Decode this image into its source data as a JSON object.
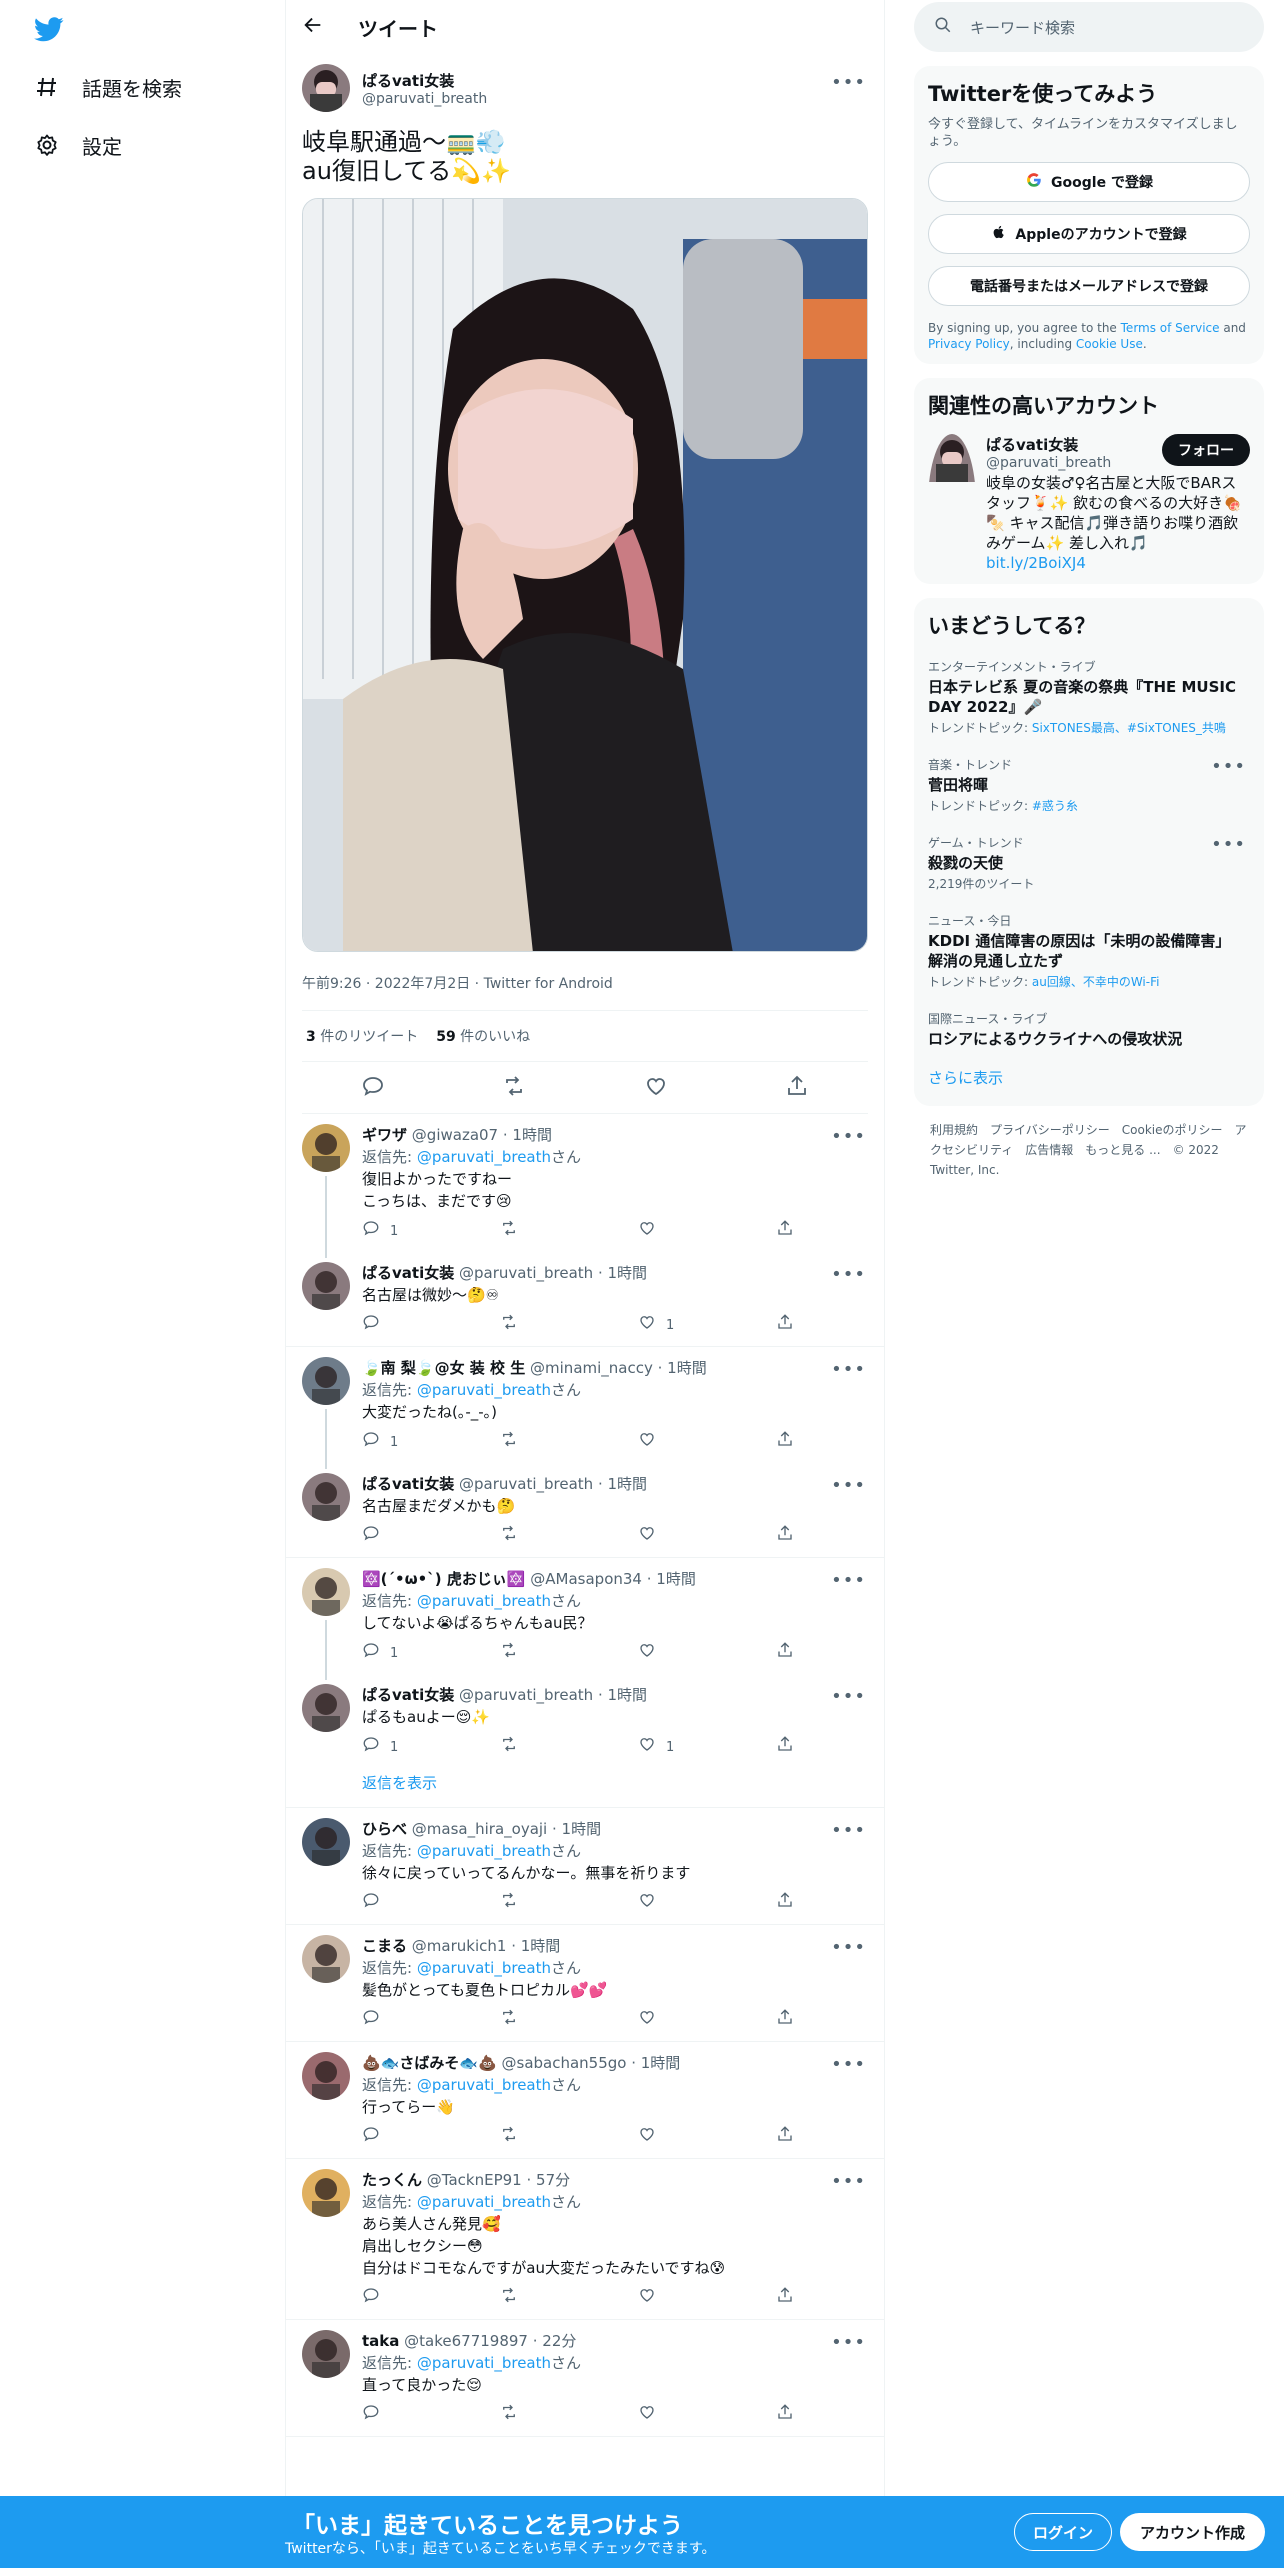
{
  "nav": {
    "explore": "話題を検索",
    "settings": "設定"
  },
  "header": {
    "title": "ツイート"
  },
  "tweet": {
    "name": "ぱるvati女装",
    "handle": "@paruvati_breath",
    "line1": "岐阜駅通過〜🚃💨",
    "line2": "au復旧してる💫✨",
    "meta": "午前9:26 · 2022年7月2日 · Twitter for Android",
    "retweets": "3",
    "retweets_label": "件のリツイート",
    "likes": "59",
    "likes_label": "件のいいね"
  },
  "reply_to_label": "返信先: ",
  "reply_to_suffix": "さん",
  "replies": [
    {
      "name": "ギワザ",
      "handle": "@giwaza07 · 1時間",
      "to": "@paruvati_breath",
      "lines": [
        "復旧よかったですねー",
        "こっちは、まだです😢"
      ],
      "reply_count": "1",
      "like_count": ""
    },
    {
      "name": "ぱるvati女装",
      "handle": "@paruvati_breath · 1時間",
      "to": "",
      "lines": [
        "名古屋は微妙〜🤔♾"
      ],
      "reply_count": "",
      "like_count": "1"
    },
    {
      "name": "🍃南 梨🍃@女 装 校 生",
      "handle": "@minami_naccy · 1時間",
      "to": "@paruvati_breath",
      "lines": [
        "大変だったね(｡-_-｡)"
      ],
      "reply_count": "1",
      "like_count": ""
    },
    {
      "name": "ぱるvati女装",
      "handle": "@paruvati_breath · 1時間",
      "to": "",
      "lines": [
        "名古屋まだダメかも🤔"
      ],
      "reply_count": "",
      "like_count": ""
    },
    {
      "name": "🔯(ˊ•ω•ˋ) 虎おじぃ🔯",
      "handle": "@AMasapon34 · 1時間",
      "to": "@paruvati_breath",
      "lines": [
        "してないよ😭ぱるちゃんもau民？"
      ],
      "reply_count": "1",
      "like_count": ""
    },
    {
      "name": "ぱるvati女装",
      "handle": "@paruvati_breath · 1時間",
      "to": "",
      "lines": [
        "ぱるもauよー😌✨"
      ],
      "reply_count": "1",
      "like_count": "1"
    },
    {
      "name": "ひらべ",
      "handle": "@masa_hira_oyaji · 1時間",
      "to": "@paruvati_breath",
      "lines": [
        "徐々に戻っていってるんかなー。無事を祈ります"
      ],
      "reply_count": "",
      "like_count": ""
    },
    {
      "name": "こまる",
      "handle": "@marukich1 · 1時間",
      "to": "@paruvati_breath",
      "lines": [
        "髪色がとっても夏色トロピカル💕💕"
      ],
      "reply_count": "",
      "like_count": ""
    },
    {
      "name": "💩🐟さばみそ🐟💩",
      "handle": "@sabachan55go · 1時間",
      "to": "@paruvati_breath",
      "lines": [
        "行ってらー👋"
      ],
      "reply_count": "",
      "like_count": ""
    },
    {
      "name": "たっくん",
      "handle": "@TacknEP91 · 57分",
      "to": "@paruvati_breath",
      "lines": [
        "あら美人さん発見🥰",
        "肩出しセクシー😳",
        "自分はドコモなんですがau大変だったみたいですね😰"
      ],
      "reply_count": "",
      "like_count": ""
    },
    {
      "name": "taka",
      "handle": "@take67719897 · 22分",
      "to": "@paruvati_breath",
      "lines": [
        "直って良かった😌"
      ],
      "reply_count": "",
      "like_count": ""
    }
  ],
  "show_replies": "返信を表示",
  "right": {
    "search_placeholder": "キーワード検索",
    "signup_title": "Twitterを使ってみよう",
    "signup_sub": "今すぐ登録して、タイムラインをカスタマイズしましょう。",
    "google_btn": "Google で登録",
    "apple_btn": "Appleのアカウントで登録",
    "phone_btn": "電話番号またはメールアドレスで登録",
    "terms_1": "By signing up, you agree to the ",
    "terms_tos": "Terms of Service",
    "terms_and": " and ",
    "terms_privacy": "Privacy Policy",
    "terms_2": ", including ",
    "terms_cookie": "Cookie Use",
    "terms_3": ".",
    "related_title": "関連性の高いアカウント",
    "related_name": "ぱるvati女装",
    "related_handle": "@paruvati_breath",
    "follow": "フォロー",
    "related_bio": "岐阜の女装♂♀名古屋と大阪でBARスタッフ🍹✨ 飲むの食べるの大好き🍖🍢 キャス配信🎵弾き語りお喋り酒飲みゲーム✨ 差し入れ🎵",
    "related_link": "bit.ly/2BoiXJ4",
    "trends_title": "いまどうしてる？",
    "trends": [
      {
        "cat": "エンターテインメント・ライブ",
        "t": "日本テレビ系 夏の音楽の祭典『THE MUSIC DAY 2022』🎤",
        "sub_label": "トレンドトピック: ",
        "sub_link": "SixTONES最高、#SixTONES_共鳴"
      },
      {
        "cat": "音楽・トレンド",
        "t": "菅田将暉",
        "sub_label": "トレンドトピック: ",
        "sub_link": "#惑う糸"
      },
      {
        "cat": "ゲーム・トレンド",
        "t": "殺戮の天使",
        "sub_label": "2,219件のツイート",
        "sub_link": ""
      },
      {
        "cat": "ニュース・今日",
        "t": "KDDI 通信障害の原因は「未明の設備障害」 解消の見通し立たず",
        "sub_label": "トレンドトピック: ",
        "sub_link": "au回線、不幸中のWi-Fi"
      },
      {
        "cat": "国際ニュース・ライブ",
        "t": "ロシアによるウクライナへの侵攻状況",
        "sub_label": "",
        "sub_link": ""
      }
    ],
    "show_more": "さらに表示",
    "footer": [
      "利用規約",
      "プライバシーポリシー",
      "Cookieのポリシー",
      "アクセシビリティ",
      "広告情報",
      "もっと見る ...",
      "© 2022 Twitter, Inc."
    ]
  },
  "bottom": {
    "title": "「いま」起きていることを見つけよう",
    "sub": "Twitterなら、「いま」起きていることをいち早くチェックできます。",
    "login": "ログイン",
    "signup": "アカウント作成"
  }
}
